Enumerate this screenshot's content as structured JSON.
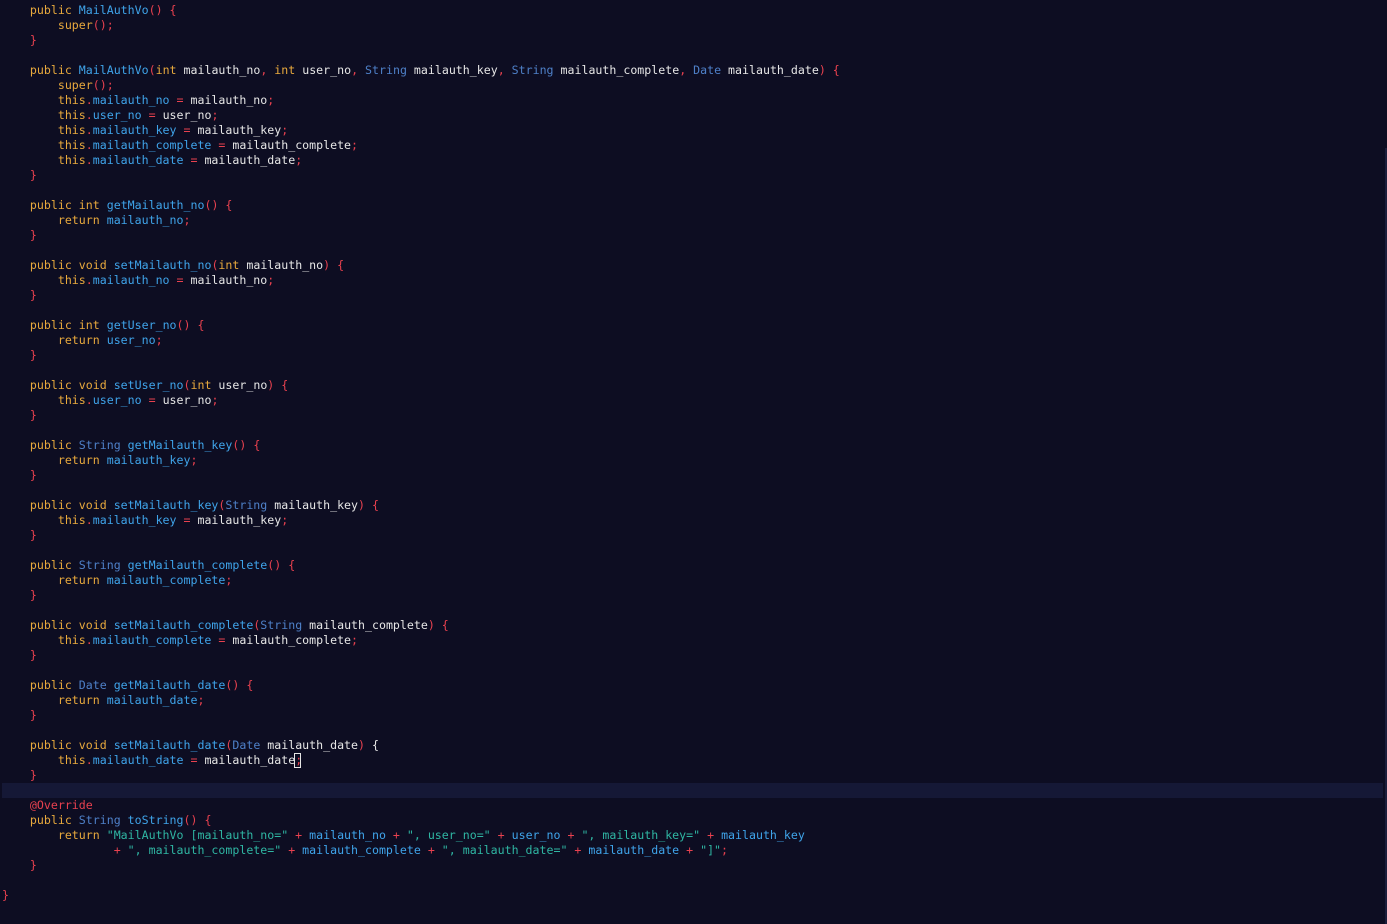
{
  "editor": {
    "language": "java",
    "current_line": 52,
    "colors": {
      "background": "#0d0d22",
      "current_line": "#151836",
      "keyword": "#e8a93d",
      "type": "#4e80c8",
      "function": "#3fa4ea",
      "punctuation": "#e8414f",
      "string": "#2fb6a3",
      "default": "#e6e6e6"
    },
    "lines": [
      [
        [
          "    ",
          ""
        ],
        [
          "public",
          "kw"
        ],
        [
          " ",
          ""
        ],
        [
          "MailAuthVo",
          "fn"
        ],
        [
          "() {",
          "pn"
        ]
      ],
      [
        [
          "        ",
          ""
        ],
        [
          "super",
          "kw"
        ],
        [
          "();",
          "pn"
        ]
      ],
      [
        [
          "    ",
          ""
        ],
        [
          "}",
          "pn"
        ]
      ],
      [],
      [
        [
          "    ",
          ""
        ],
        [
          "public",
          "kw"
        ],
        [
          " ",
          ""
        ],
        [
          "MailAuthVo",
          "fn"
        ],
        [
          "(",
          "pn"
        ],
        [
          "int",
          "kw"
        ],
        [
          " mailauth_no",
          "vr"
        ],
        [
          ", ",
          "pn"
        ],
        [
          "int",
          "kw"
        ],
        [
          " user_no",
          "vr"
        ],
        [
          ", ",
          "pn"
        ],
        [
          "String",
          "ty"
        ],
        [
          " mailauth_key",
          "vr"
        ],
        [
          ", ",
          "pn"
        ],
        [
          "String",
          "ty"
        ],
        [
          " mailauth_complete",
          "vr"
        ],
        [
          ", ",
          "pn"
        ],
        [
          "Date",
          "ty"
        ],
        [
          " mailauth_date",
          "vr"
        ],
        [
          ") {",
          "pn"
        ]
      ],
      [
        [
          "        ",
          ""
        ],
        [
          "super",
          "kw"
        ],
        [
          "();",
          "pn"
        ]
      ],
      [
        [
          "        ",
          ""
        ],
        [
          "this",
          "kw"
        ],
        [
          ".",
          "pn"
        ],
        [
          "mailauth_no",
          "fd"
        ],
        [
          " = ",
          "op"
        ],
        [
          "mailauth_no",
          "vr"
        ],
        [
          ";",
          "pn"
        ]
      ],
      [
        [
          "        ",
          ""
        ],
        [
          "this",
          "kw"
        ],
        [
          ".",
          "pn"
        ],
        [
          "user_no",
          "fd"
        ],
        [
          " = ",
          "op"
        ],
        [
          "user_no",
          "vr"
        ],
        [
          ";",
          "pn"
        ]
      ],
      [
        [
          "        ",
          ""
        ],
        [
          "this",
          "kw"
        ],
        [
          ".",
          "pn"
        ],
        [
          "mailauth_key",
          "fd"
        ],
        [
          " = ",
          "op"
        ],
        [
          "mailauth_key",
          "vr"
        ],
        [
          ";",
          "pn"
        ]
      ],
      [
        [
          "        ",
          ""
        ],
        [
          "this",
          "kw"
        ],
        [
          ".",
          "pn"
        ],
        [
          "mailauth_complete",
          "fd"
        ],
        [
          " = ",
          "op"
        ],
        [
          "mailauth_complete",
          "vr"
        ],
        [
          ";",
          "pn"
        ]
      ],
      [
        [
          "        ",
          ""
        ],
        [
          "this",
          "kw"
        ],
        [
          ".",
          "pn"
        ],
        [
          "mailauth_date",
          "fd"
        ],
        [
          " = ",
          "op"
        ],
        [
          "mailauth_date",
          "vr"
        ],
        [
          ";",
          "pn"
        ]
      ],
      [
        [
          "    ",
          ""
        ],
        [
          "}",
          "pn"
        ]
      ],
      [],
      [
        [
          "    ",
          ""
        ],
        [
          "public",
          "kw"
        ],
        [
          " ",
          ""
        ],
        [
          "int",
          "kw"
        ],
        [
          " ",
          ""
        ],
        [
          "getMailauth_no",
          "fn"
        ],
        [
          "() {",
          "pn"
        ]
      ],
      [
        [
          "        ",
          ""
        ],
        [
          "return",
          "kw"
        ],
        [
          " ",
          ""
        ],
        [
          "mailauth_no",
          "fd"
        ],
        [
          ";",
          "pn"
        ]
      ],
      [
        [
          "    ",
          ""
        ],
        [
          "}",
          "pn"
        ]
      ],
      [],
      [
        [
          "    ",
          ""
        ],
        [
          "public",
          "kw"
        ],
        [
          " ",
          ""
        ],
        [
          "void",
          "kw"
        ],
        [
          " ",
          ""
        ],
        [
          "setMailauth_no",
          "fn"
        ],
        [
          "(",
          "pn"
        ],
        [
          "int",
          "kw"
        ],
        [
          " mailauth_no",
          "vr"
        ],
        [
          ") {",
          "pn"
        ]
      ],
      [
        [
          "        ",
          ""
        ],
        [
          "this",
          "kw"
        ],
        [
          ".",
          "pn"
        ],
        [
          "mailauth_no",
          "fd"
        ],
        [
          " = ",
          "op"
        ],
        [
          "mailauth_no",
          "vr"
        ],
        [
          ";",
          "pn"
        ]
      ],
      [
        [
          "    ",
          ""
        ],
        [
          "}",
          "pn"
        ]
      ],
      [],
      [
        [
          "    ",
          ""
        ],
        [
          "public",
          "kw"
        ],
        [
          " ",
          ""
        ],
        [
          "int",
          "kw"
        ],
        [
          " ",
          ""
        ],
        [
          "getUser_no",
          "fn"
        ],
        [
          "() {",
          "pn"
        ]
      ],
      [
        [
          "        ",
          ""
        ],
        [
          "return",
          "kw"
        ],
        [
          " ",
          ""
        ],
        [
          "user_no",
          "fd"
        ],
        [
          ";",
          "pn"
        ]
      ],
      [
        [
          "    ",
          ""
        ],
        [
          "}",
          "pn"
        ]
      ],
      [],
      [
        [
          "    ",
          ""
        ],
        [
          "public",
          "kw"
        ],
        [
          " ",
          ""
        ],
        [
          "void",
          "kw"
        ],
        [
          " ",
          ""
        ],
        [
          "setUser_no",
          "fn"
        ],
        [
          "(",
          "pn"
        ],
        [
          "int",
          "kw"
        ],
        [
          " user_no",
          "vr"
        ],
        [
          ") {",
          "pn"
        ]
      ],
      [
        [
          "        ",
          ""
        ],
        [
          "this",
          "kw"
        ],
        [
          ".",
          "pn"
        ],
        [
          "user_no",
          "fd"
        ],
        [
          " = ",
          "op"
        ],
        [
          "user_no",
          "vr"
        ],
        [
          ";",
          "pn"
        ]
      ],
      [
        [
          "    ",
          ""
        ],
        [
          "}",
          "pn"
        ]
      ],
      [],
      [
        [
          "    ",
          ""
        ],
        [
          "public",
          "kw"
        ],
        [
          " ",
          ""
        ],
        [
          "String",
          "ty"
        ],
        [
          " ",
          ""
        ],
        [
          "getMailauth_key",
          "fn"
        ],
        [
          "() {",
          "pn"
        ]
      ],
      [
        [
          "        ",
          ""
        ],
        [
          "return",
          "kw"
        ],
        [
          " ",
          ""
        ],
        [
          "mailauth_key",
          "fd"
        ],
        [
          ";",
          "pn"
        ]
      ],
      [
        [
          "    ",
          ""
        ],
        [
          "}",
          "pn"
        ]
      ],
      [],
      [
        [
          "    ",
          ""
        ],
        [
          "public",
          "kw"
        ],
        [
          " ",
          ""
        ],
        [
          "void",
          "kw"
        ],
        [
          " ",
          ""
        ],
        [
          "setMailauth_key",
          "fn"
        ],
        [
          "(",
          "pn"
        ],
        [
          "String",
          "ty"
        ],
        [
          " mailauth_key",
          "vr"
        ],
        [
          ") {",
          "pn"
        ]
      ],
      [
        [
          "        ",
          ""
        ],
        [
          "this",
          "kw"
        ],
        [
          ".",
          "pn"
        ],
        [
          "mailauth_key",
          "fd"
        ],
        [
          " = ",
          "op"
        ],
        [
          "mailauth_key",
          "vr"
        ],
        [
          ";",
          "pn"
        ]
      ],
      [
        [
          "    ",
          ""
        ],
        [
          "}",
          "pn"
        ]
      ],
      [],
      [
        [
          "    ",
          ""
        ],
        [
          "public",
          "kw"
        ],
        [
          " ",
          ""
        ],
        [
          "String",
          "ty"
        ],
        [
          " ",
          ""
        ],
        [
          "getMailauth_complete",
          "fn"
        ],
        [
          "() {",
          "pn"
        ]
      ],
      [
        [
          "        ",
          ""
        ],
        [
          "return",
          "kw"
        ],
        [
          " ",
          ""
        ],
        [
          "mailauth_complete",
          "fd"
        ],
        [
          ";",
          "pn"
        ]
      ],
      [
        [
          "    ",
          ""
        ],
        [
          "}",
          "pn"
        ]
      ],
      [],
      [
        [
          "    ",
          ""
        ],
        [
          "public",
          "kw"
        ],
        [
          " ",
          ""
        ],
        [
          "void",
          "kw"
        ],
        [
          " ",
          ""
        ],
        [
          "setMailauth_complete",
          "fn"
        ],
        [
          "(",
          "pn"
        ],
        [
          "String",
          "ty"
        ],
        [
          " mailauth_complete",
          "vr"
        ],
        [
          ") {",
          "pn"
        ]
      ],
      [
        [
          "        ",
          ""
        ],
        [
          "this",
          "kw"
        ],
        [
          ".",
          "pn"
        ],
        [
          "mailauth_complete",
          "fd"
        ],
        [
          " = ",
          "op"
        ],
        [
          "mailauth_complete",
          "vr"
        ],
        [
          ";",
          "pn"
        ]
      ],
      [
        [
          "    ",
          ""
        ],
        [
          "}",
          "pn"
        ]
      ],
      [],
      [
        [
          "    ",
          ""
        ],
        [
          "public",
          "kw"
        ],
        [
          " ",
          ""
        ],
        [
          "Date",
          "ty"
        ],
        [
          " ",
          ""
        ],
        [
          "getMailauth_date",
          "fn"
        ],
        [
          "() {",
          "pn"
        ]
      ],
      [
        [
          "        ",
          ""
        ],
        [
          "return",
          "kw"
        ],
        [
          " ",
          ""
        ],
        [
          "mailauth_date",
          "fd"
        ],
        [
          ";",
          "pn"
        ]
      ],
      [
        [
          "    ",
          ""
        ],
        [
          "}",
          "pn"
        ]
      ],
      [],
      [
        [
          "    ",
          ""
        ],
        [
          "public",
          "kw"
        ],
        [
          " ",
          ""
        ],
        [
          "void",
          "kw"
        ],
        [
          " ",
          ""
        ],
        [
          "setMailauth_date",
          "fn"
        ],
        [
          "(",
          "pn"
        ],
        [
          "Date",
          "ty"
        ],
        [
          " mailauth_date",
          "vr"
        ],
        [
          ") ",
          "pn"
        ],
        [
          "{",
          "vr"
        ]
      ],
      [
        [
          "        ",
          ""
        ],
        [
          "this",
          "kw"
        ],
        [
          ".",
          "pn"
        ],
        [
          "mailauth_date",
          "fd"
        ],
        [
          " = ",
          "op"
        ],
        [
          "mailauth_date",
          "vr"
        ],
        [
          ";",
          "pn"
        ]
      ],
      [
        [
          "    ",
          ""
        ],
        [
          "}",
          "pn"
        ]
      ],
      [],
      [
        [
          "    ",
          ""
        ],
        [
          "@Override",
          "an"
        ]
      ],
      [
        [
          "    ",
          ""
        ],
        [
          "public",
          "kw"
        ],
        [
          " ",
          ""
        ],
        [
          "String",
          "ty"
        ],
        [
          " ",
          ""
        ],
        [
          "toString",
          "fn"
        ],
        [
          "() {",
          "pn"
        ]
      ],
      [
        [
          "        ",
          ""
        ],
        [
          "return",
          "kw"
        ],
        [
          " ",
          ""
        ],
        [
          "\"MailAuthVo [mailauth_no=\"",
          "st"
        ],
        [
          " + ",
          "op"
        ],
        [
          "mailauth_no",
          "fd"
        ],
        [
          " + ",
          "op"
        ],
        [
          "\", user_no=\"",
          "st"
        ],
        [
          " + ",
          "op"
        ],
        [
          "user_no",
          "fd"
        ],
        [
          " + ",
          "op"
        ],
        [
          "\", mailauth_key=\"",
          "st"
        ],
        [
          " + ",
          "op"
        ],
        [
          "mailauth_key",
          "fd"
        ]
      ],
      [
        [
          "                ",
          ""
        ],
        [
          "+ ",
          "op"
        ],
        [
          "\", mailauth_complete=\"",
          "st"
        ],
        [
          " + ",
          "op"
        ],
        [
          "mailauth_complete",
          "fd"
        ],
        [
          " + ",
          "op"
        ],
        [
          "\", mailauth_date=\"",
          "st"
        ],
        [
          " + ",
          "op"
        ],
        [
          "mailauth_date",
          "fd"
        ],
        [
          " + ",
          "op"
        ],
        [
          "\"]\"",
          "st"
        ],
        [
          ";",
          "pn"
        ]
      ],
      [
        [
          "    ",
          ""
        ],
        [
          "}",
          "pn"
        ]
      ],
      [],
      [
        [
          "}",
          "pn"
        ]
      ]
    ]
  }
}
